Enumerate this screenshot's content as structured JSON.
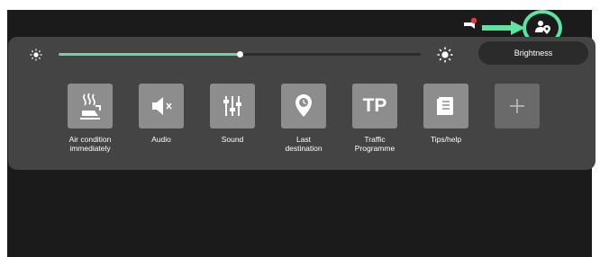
{
  "panel": {
    "brightness": {
      "label": "Brightness",
      "level": 0.5
    },
    "tiles": [
      {
        "label": "Air condition\nimmediately",
        "icon": "air-condition-icon"
      },
      {
        "label": "Audio",
        "icon": "audio-mute-icon"
      },
      {
        "label": "Sound",
        "icon": "sound-equalizer-icon"
      },
      {
        "label": "Last\ndestination",
        "icon": "last-destination-icon"
      },
      {
        "label": "Traffic\nProgramme",
        "icon": "traffic-programme-icon",
        "icon_text": "TP"
      },
      {
        "label": "Tips/help",
        "icon": "tips-help-icon"
      },
      {
        "label": "",
        "icon": "add-icon"
      }
    ]
  },
  "status_bar": {
    "icons": [
      "notification-icon",
      "profile-location-icon"
    ]
  },
  "colors": {
    "accent": "#5fe3a1",
    "screen_bg": "#1b1b1b",
    "panel_bg": "#444444",
    "tile_bg": "#8d8d8d"
  }
}
